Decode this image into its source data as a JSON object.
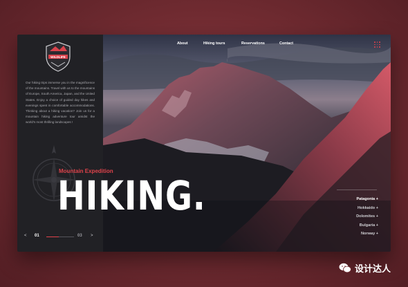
{
  "brand": {
    "logo_text": "WILDLIFE"
  },
  "nav": {
    "about": "About",
    "hiking_tours": "Hiking tours",
    "reservations": "Reservations",
    "contact": "Contact"
  },
  "intro_text": "Our hiking trips immerse you in the magnificence of the mountains. Travel with us to the mountains of Europe, South America, Japan, and the United States. Enjoy a choice of guided day hikes and evenings spent in comfortable accommodations. Thinking about a hiking vacation? Join us for a mountain hiking adventure tour amidst the world's most thrilling landscapes !",
  "hero": {
    "subtitle": "Mountain Expedition",
    "title": "HIKING."
  },
  "destinations": [
    {
      "label": "Patagonia +",
      "active": true
    },
    {
      "label": "Hokkaido +",
      "active": false
    },
    {
      "label": "Dolomites +",
      "active": false
    },
    {
      "label": "Bulgaria +",
      "active": false
    },
    {
      "label": "Norway +",
      "active": false
    }
  ],
  "pager": {
    "prev": "<",
    "current": "01",
    "total": "03",
    "next": ">",
    "progress": 0.45
  },
  "watermark": "设计达人",
  "colors": {
    "accent": "#e0434b",
    "sidebar": "#212125",
    "backdrop": "#6e2a30"
  }
}
